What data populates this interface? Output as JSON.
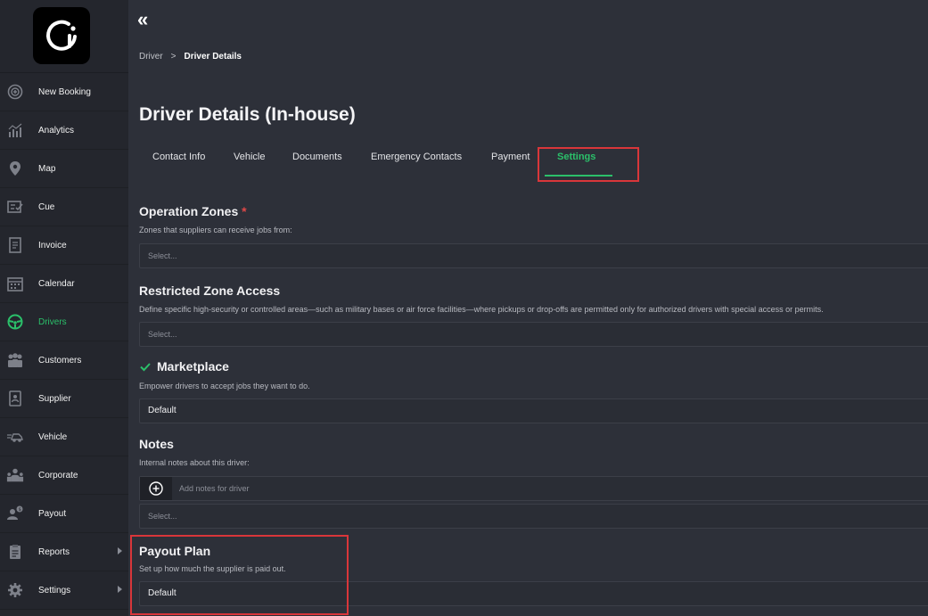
{
  "sidebar": {
    "items": [
      {
        "label": "New Booking",
        "icon": "plus-circle-icon"
      },
      {
        "label": "Analytics",
        "icon": "bar-chart-icon"
      },
      {
        "label": "Map",
        "icon": "map-pin-icon"
      },
      {
        "label": "Cue",
        "icon": "checklist-icon"
      },
      {
        "label": "Invoice",
        "icon": "invoice-icon"
      },
      {
        "label": "Calendar",
        "icon": "calendar-icon"
      },
      {
        "label": "Drivers",
        "icon": "steering-wheel-icon",
        "active": true
      },
      {
        "label": "Customers",
        "icon": "customers-icon"
      },
      {
        "label": "Supplier",
        "icon": "supplier-icon"
      },
      {
        "label": "Vehicle",
        "icon": "vehicle-icon"
      },
      {
        "label": "Corporate",
        "icon": "corporate-icon"
      },
      {
        "label": "Payout",
        "icon": "payout-icon"
      },
      {
        "label": "Reports",
        "icon": "clipboard-icon",
        "submenu": true
      },
      {
        "label": "Settings",
        "icon": "gear-icon",
        "submenu": true
      }
    ],
    "accent_color": "#2bc06a"
  },
  "breadcrumb": {
    "parent": "Driver",
    "separator": ">",
    "current": "Driver Details"
  },
  "page_title": "Driver Details (In-house)",
  "tabs": [
    {
      "label": "Contact Info"
    },
    {
      "label": "Vehicle"
    },
    {
      "label": "Documents"
    },
    {
      "label": "Emergency Contacts"
    },
    {
      "label": "Payment"
    },
    {
      "label": "Settings",
      "active": true
    }
  ],
  "sections": {
    "operation_zones": {
      "title": "Operation Zones",
      "required_mark": "*",
      "description": "Zones that suppliers can receive jobs from:",
      "placeholder": "Select..."
    },
    "restricted_zone": {
      "title": "Restricted Zone Access",
      "description": "Define specific high-security or controlled areas—such as military bases or air force facilities—where pickups or drop-offs are permitted only for authorized drivers with special access or permits.",
      "placeholder": "Select..."
    },
    "marketplace": {
      "title": "Marketplace",
      "description": "Empower drivers to accept jobs they want to do.",
      "value": "Default"
    },
    "notes": {
      "title": "Notes",
      "description": "Internal notes about this driver:",
      "input_placeholder": "Add notes for driver",
      "select_placeholder": "Select..."
    },
    "payout_plan": {
      "title": "Payout Plan",
      "description": "Set up how much the supplier is paid out.",
      "value": "Default"
    }
  },
  "highlight_color": "#d9363a"
}
